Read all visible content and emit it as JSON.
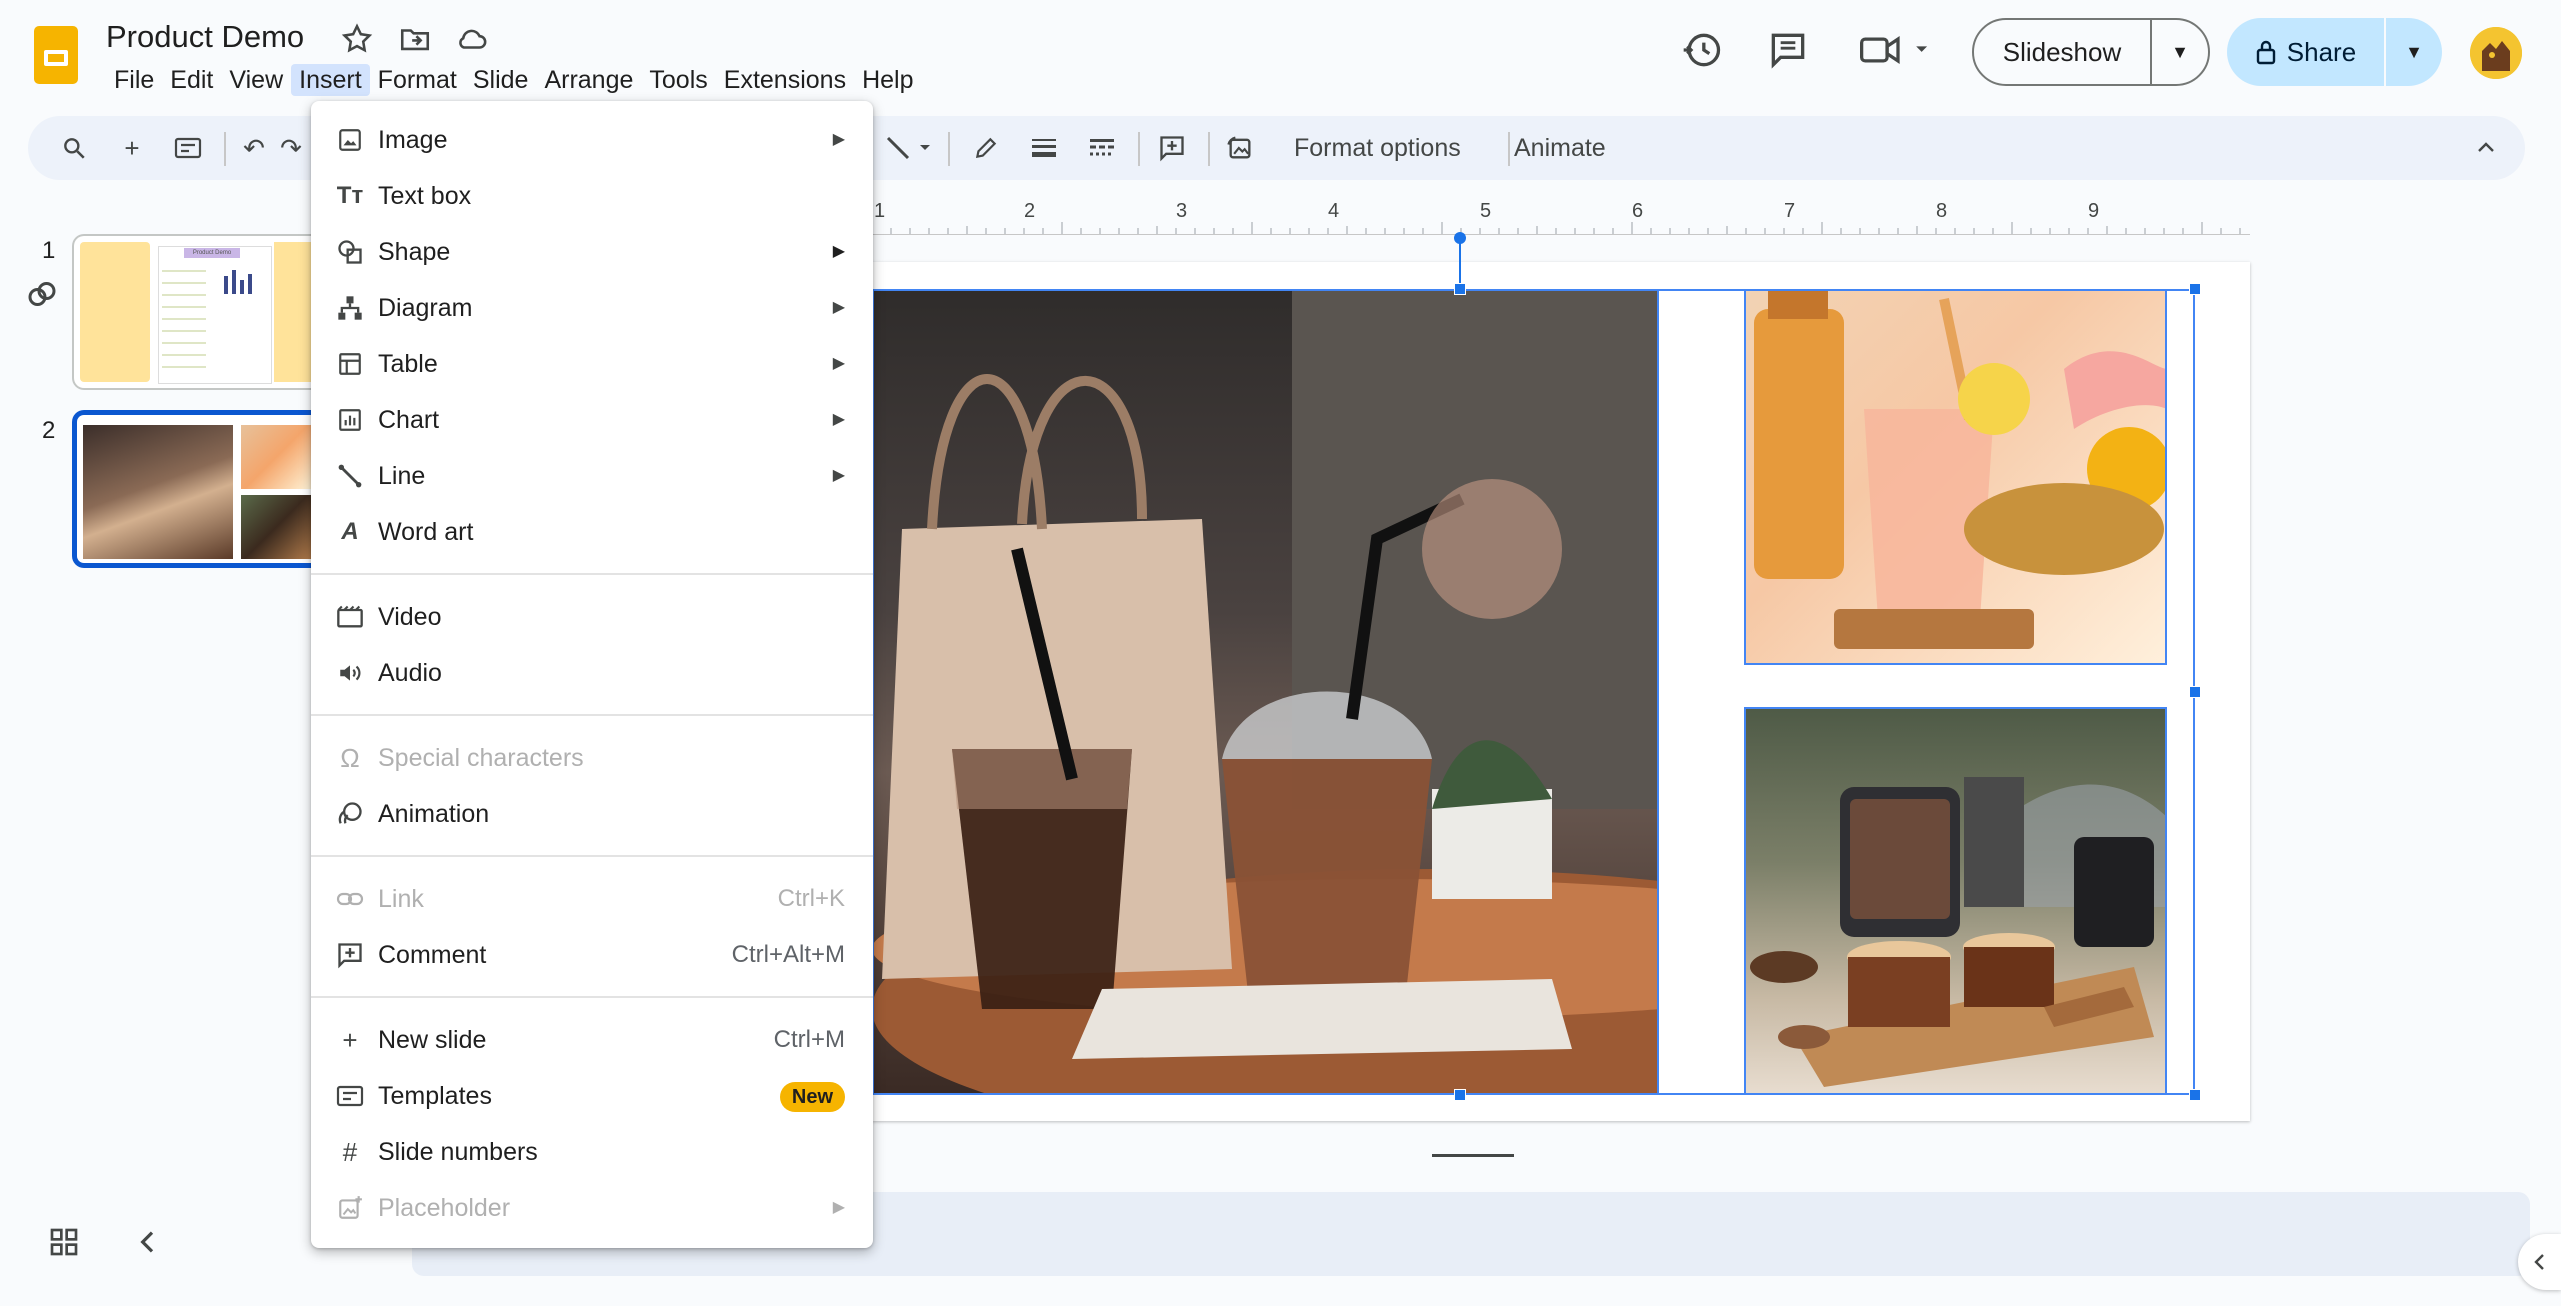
{
  "header": {
    "doc_title": "Product Demo",
    "menus": [
      "File",
      "Edit",
      "View",
      "Insert",
      "Format",
      "Slide",
      "Arrange",
      "Tools",
      "Extensions",
      "Help"
    ],
    "active_menu": "Insert",
    "slideshow_label": "Slideshow",
    "share_label": "Share"
  },
  "toolbar": {
    "format_options": "Format options",
    "animate": "Animate"
  },
  "filmstrip": {
    "slides": [
      {
        "number": "1",
        "title_snippet": "Product Demo"
      },
      {
        "number": "2"
      }
    ]
  },
  "ruler": {
    "ticks": [
      "1",
      "2",
      "3",
      "4",
      "5",
      "6",
      "7",
      "8",
      "9"
    ]
  },
  "insert_menu": {
    "items": [
      {
        "label": "Image",
        "icon": "image-icon",
        "submenu": true
      },
      {
        "label": "Text box",
        "icon": "text-box-icon"
      },
      {
        "label": "Shape",
        "icon": "shape-icon",
        "submenu": true
      },
      {
        "label": "Diagram",
        "icon": "diagram-icon",
        "submenu": true
      },
      {
        "label": "Table",
        "icon": "table-icon",
        "submenu": true
      },
      {
        "label": "Chart",
        "icon": "chart-icon",
        "submenu": true
      },
      {
        "label": "Line",
        "icon": "line-icon",
        "submenu": true
      },
      {
        "label": "Word art",
        "icon": "word-art-icon"
      },
      {
        "label": "Video",
        "icon": "video-icon"
      },
      {
        "label": "Audio",
        "icon": "audio-icon"
      },
      {
        "label": "Special characters",
        "icon": "omega-icon",
        "disabled": true
      },
      {
        "label": "Animation",
        "icon": "animation-icon"
      },
      {
        "label": "Link",
        "icon": "link-icon",
        "shortcut": "Ctrl+K",
        "disabled": true
      },
      {
        "label": "Comment",
        "icon": "comment-icon",
        "shortcut": "Ctrl+Alt+M"
      },
      {
        "label": "New slide",
        "icon": "plus-icon",
        "shortcut": "Ctrl+M"
      },
      {
        "label": "Templates",
        "icon": "templates-icon",
        "badge": "New"
      },
      {
        "label": "Slide numbers",
        "icon": "hash-icon"
      },
      {
        "label": "Placeholder",
        "icon": "placeholder-icon",
        "submenu": true,
        "disabled": true
      }
    ]
  },
  "colors": {
    "accent": "#0b57d0",
    "share_bg": "#c2e7ff",
    "logo": "#f6b400",
    "badge": "#f6b400"
  }
}
